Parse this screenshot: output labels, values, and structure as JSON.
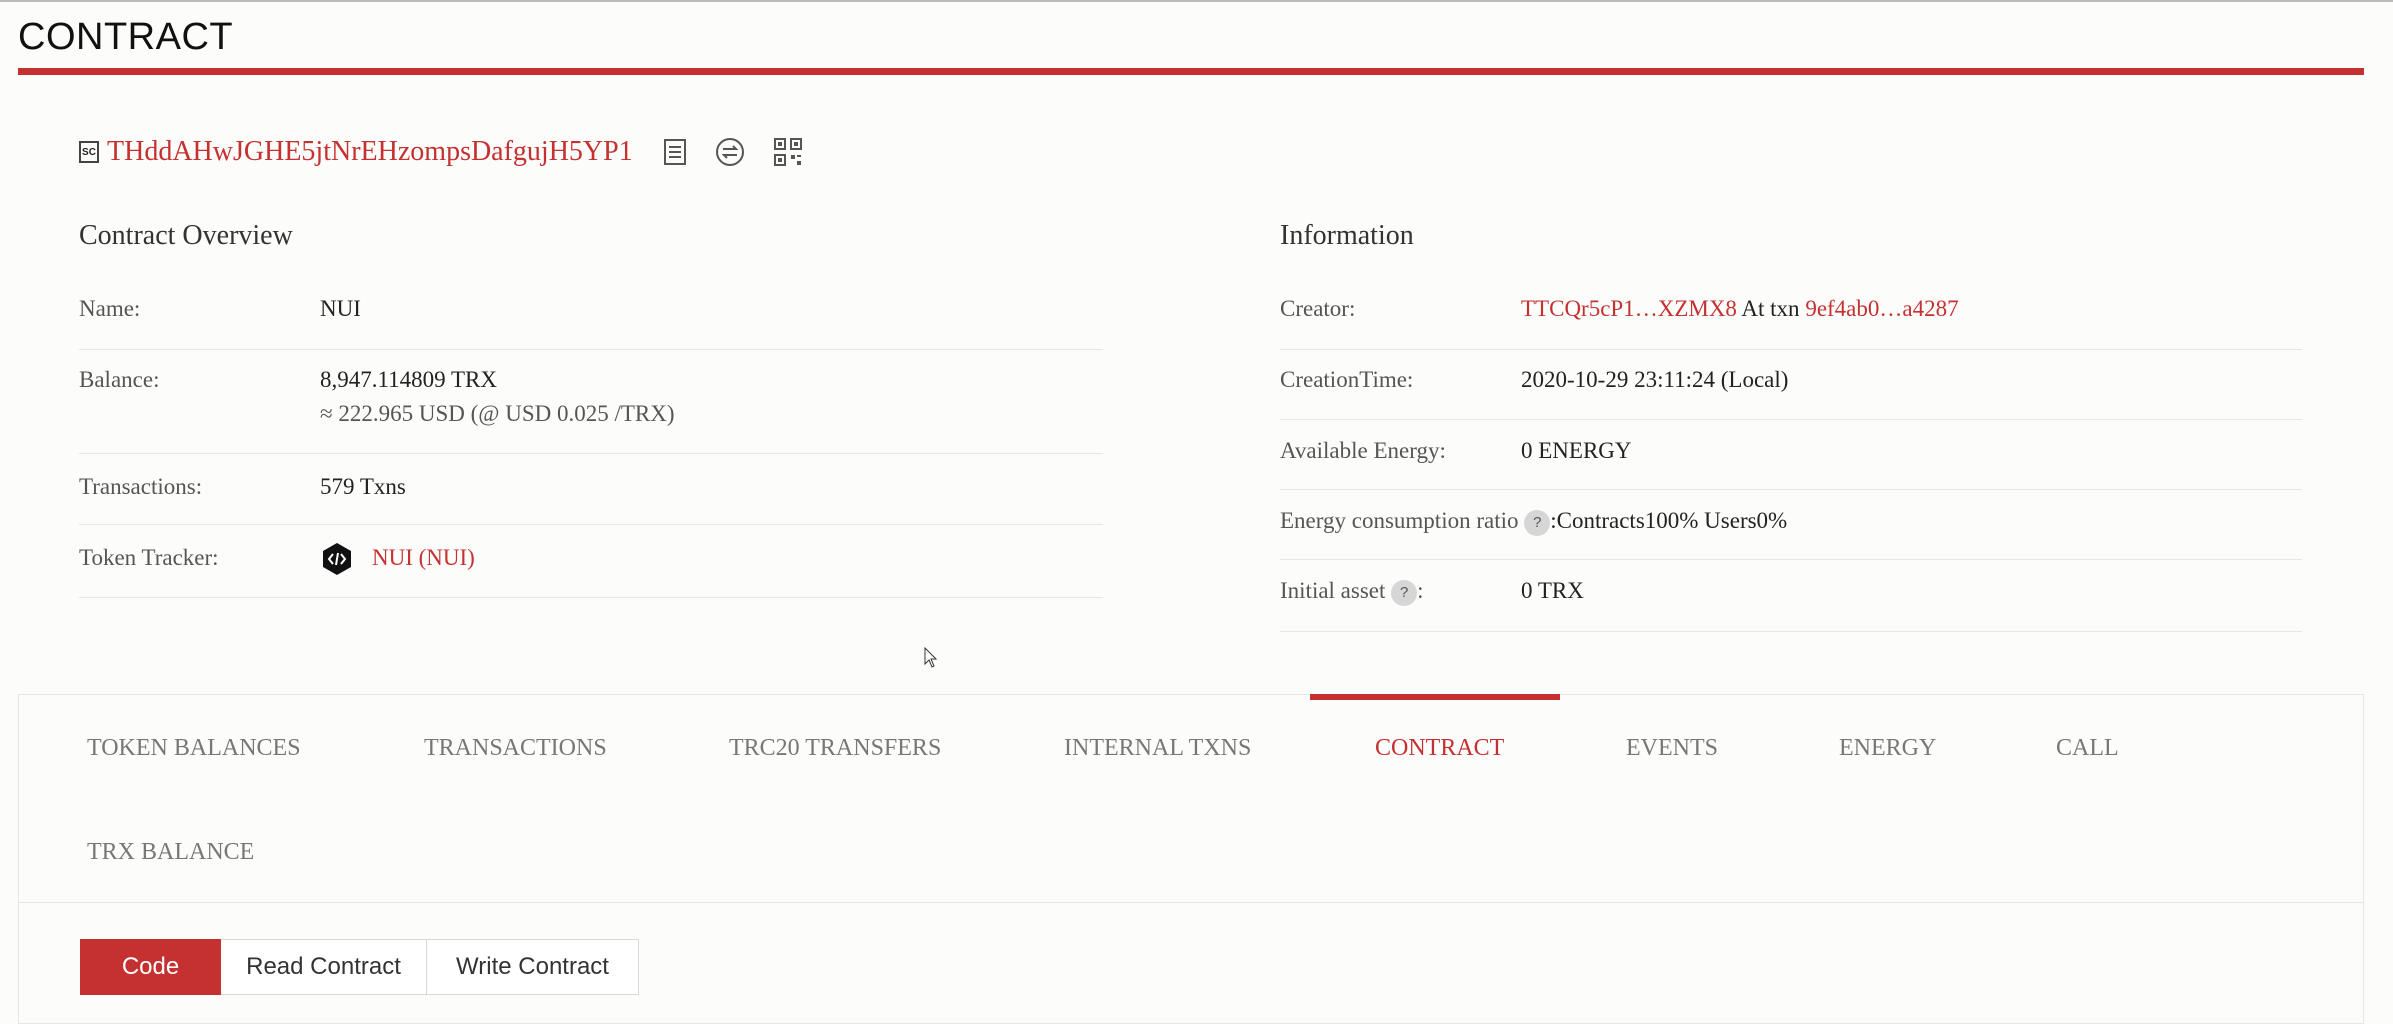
{
  "page": {
    "title": "CONTRACT"
  },
  "contract": {
    "address": "THddAHwJGHE5jtNrEHzompsDafgujH5YP1",
    "badge": "SC"
  },
  "overview": {
    "heading": "Contract Overview",
    "rows": [
      {
        "label": "Name:",
        "value": "NUI"
      },
      {
        "label": "Balance:",
        "value": "8,947.114809 TRX",
        "sub": "≈ 222.965 USD (@ USD 0.025 /TRX)"
      },
      {
        "label": "Transactions:",
        "value": "579  Txns"
      },
      {
        "label": "Token Tracker:",
        "value": "NUI (NUI)"
      }
    ]
  },
  "information": {
    "heading": "Information",
    "creator": {
      "label": "Creator:",
      "address": "TTCQr5cP1…XZMX8",
      "at_txn": "At txn",
      "txn": "9ef4ab0…a4287"
    },
    "creation_time": {
      "label": "CreationTime:",
      "value": "2020-10-29 23:11:24 (Local)"
    },
    "available_energy": {
      "label": "Available Energy:",
      "value": "0  ENERGY"
    },
    "energy_ratio": {
      "label": "Energy consumption ratio",
      "q": "?",
      "value": ":Contracts100%  Users0%"
    },
    "initial_asset": {
      "label": "Initial asset",
      "q": "?",
      "colon": ":",
      "value": "0 TRX"
    }
  },
  "tabs": [
    {
      "label": "TOKEN BALANCES",
      "active": false
    },
    {
      "label": "TRANSACTIONS",
      "active": false
    },
    {
      "label": "TRC20 TRANSFERS",
      "active": false
    },
    {
      "label": "INTERNAL TXNS",
      "active": false
    },
    {
      "label": "CONTRACT",
      "active": true
    },
    {
      "label": "EVENTS",
      "active": false
    },
    {
      "label": "ENERGY",
      "active": false
    },
    {
      "label": "CALL",
      "active": false
    },
    {
      "label": "TRX BALANCE",
      "active": false
    }
  ],
  "contract_buttons": [
    {
      "label": "Code",
      "active": true
    },
    {
      "label": "Read Contract",
      "active": false
    },
    {
      "label": "Write Contract",
      "active": false
    }
  ],
  "colors": {
    "accent": "#c53030",
    "border": "#e6e6e6",
    "background": "#fcfcfb"
  },
  "icons": [
    "copy-icon",
    "transfer-icon",
    "qr-code-icon",
    "token-code-icon",
    "mouse-cursor-icon"
  ]
}
